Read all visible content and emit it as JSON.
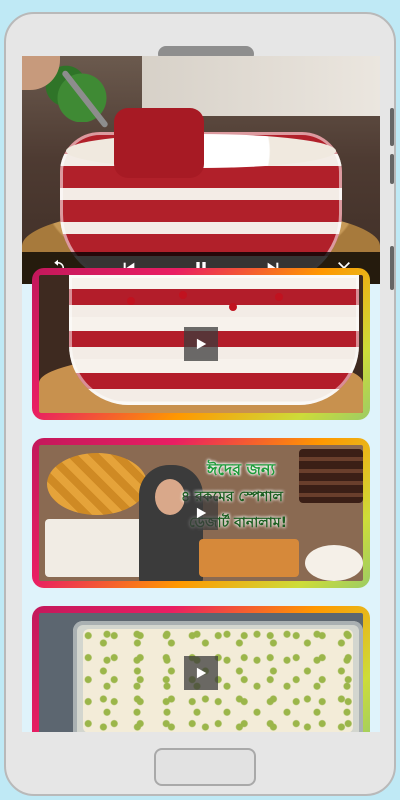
{
  "player": {
    "controls": [
      {
        "name": "replay-icon",
        "glyph": "↺"
      },
      {
        "name": "previous-icon",
        "glyph": "⏮"
      },
      {
        "name": "pause-icon",
        "glyph": "⏸"
      },
      {
        "name": "next-icon",
        "glyph": "⏭"
      },
      {
        "name": "close-icon",
        "glyph": "✕"
      }
    ]
  },
  "cards": [
    {
      "name": "video-card-red-velvet"
    },
    {
      "name": "video-card-eid-desserts",
      "title_line1": "ঈদের জন্য",
      "title_line2": "৪ রকমের স্পেশাল",
      "title_line3": "ডেজার্ট বানালাম!"
    },
    {
      "name": "video-card-pistachio-dessert"
    }
  ],
  "colors": {
    "background": "#bfe9f5",
    "card_gradient_start": "#c2185b",
    "card_gradient_end": "#9ccc65",
    "title_green": "#1e9b3a"
  }
}
